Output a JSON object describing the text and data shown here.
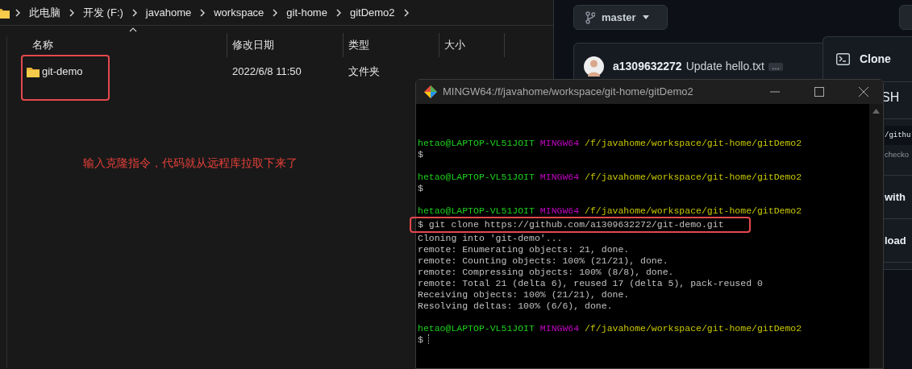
{
  "explorer": {
    "breadcrumb": [
      {
        "label": "此电脑"
      },
      {
        "label": "开发 (F:)"
      },
      {
        "label": "javahome"
      },
      {
        "label": "workspace"
      },
      {
        "label": "git-home"
      },
      {
        "label": "gitDemo2"
      }
    ],
    "columns": [
      "名称",
      "修改日期",
      "类型",
      "大小"
    ],
    "rows": [
      {
        "name": "git-demo",
        "modified": "2022/6/8 11:50",
        "type": "文件夹"
      }
    ]
  },
  "annotation": {
    "text": "输入克隆指令，代码就从远程库拉取下来了"
  },
  "github": {
    "branch": "master",
    "commit": {
      "author": "a1309632272",
      "message": "Update hello.txt",
      "more": "…"
    },
    "clone_menu": {
      "title": "Clone",
      "tab_fragment": "SH",
      "url_fragment": "/githu",
      "hint_fragment": "checko",
      "items": [
        "with",
        "load"
      ]
    }
  },
  "terminal": {
    "title": "MINGW64:/f/javahome/workspace/git-home/gitDemo2",
    "lines": [
      {
        "kind": "blank"
      },
      {
        "kind": "blank"
      },
      {
        "kind": "blank"
      },
      {
        "kind": "prompt",
        "user": "hetao@LAPTOP-VL51JOIT",
        "shell": "MINGW64",
        "path": "/f/javahome/workspace/git-home/gitDemo2"
      },
      {
        "kind": "input",
        "text": "$",
        "cursor": false,
        "highlighted": false
      },
      {
        "kind": "blank"
      },
      {
        "kind": "prompt",
        "user": "hetao@LAPTOP-VL51JOIT",
        "shell": "MINGW64",
        "path": "/f/javahome/workspace/git-home/gitDemo2"
      },
      {
        "kind": "input",
        "text": "$",
        "cursor": false,
        "highlighted": false
      },
      {
        "kind": "blank"
      },
      {
        "kind": "prompt",
        "user": "hetao@LAPTOP-VL51JOIT",
        "shell": "MINGW64",
        "path": "/f/javahome/workspace/git-home/gitDemo2"
      },
      {
        "kind": "input",
        "text": "$ git clone https://github.com/a1309632272/git-demo.git",
        "cursor": false,
        "highlighted": true
      },
      {
        "kind": "output",
        "text": "Cloning into 'git-demo'..."
      },
      {
        "kind": "output",
        "text": "remote: Enumerating objects: 21, done."
      },
      {
        "kind": "output",
        "text": "remote: Counting objects: 100% (21/21), done."
      },
      {
        "kind": "output",
        "text": "remote: Compressing objects: 100% (8/8), done."
      },
      {
        "kind": "output",
        "text": "remote: Total 21 (delta 6), reused 17 (delta 5), pack-reused 0"
      },
      {
        "kind": "output",
        "text": "Receiving objects: 100% (21/21), done."
      },
      {
        "kind": "output",
        "text": "Resolving deltas: 100% (6/6), done."
      },
      {
        "kind": "blank"
      },
      {
        "kind": "prompt",
        "user": "hetao@LAPTOP-VL51JOIT",
        "shell": "MINGW64",
        "path": "/f/javahome/workspace/git-home/gitDemo2"
      },
      {
        "kind": "input",
        "text": "$",
        "cursor": true,
        "highlighted": false
      }
    ]
  }
}
